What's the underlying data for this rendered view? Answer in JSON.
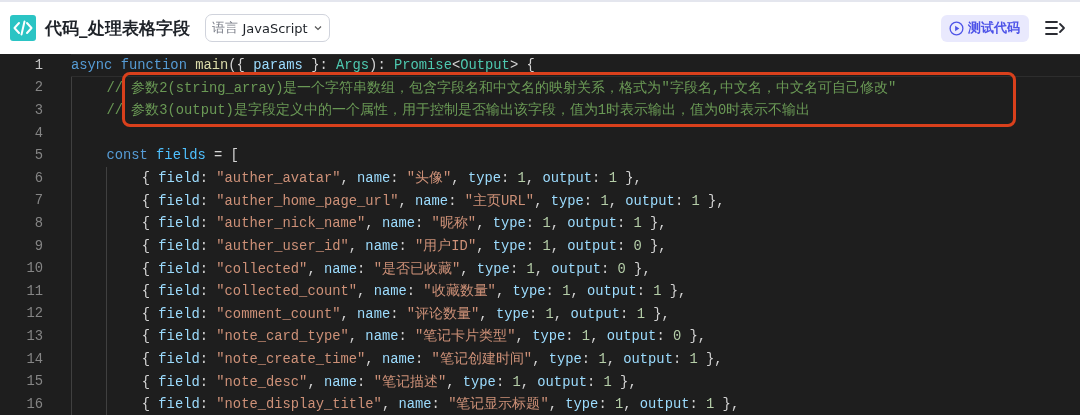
{
  "header": {
    "title": "代码_处理表格字段",
    "language": {
      "label": "语言",
      "value": "JavaScript"
    },
    "test_button": "测试代码"
  },
  "editor": {
    "lines": [
      {
        "number": "1",
        "current": true,
        "boxed": false,
        "tokens": [
          {
            "kind": "keyword",
            "text": "async "
          },
          {
            "kind": "keyword",
            "text": "function "
          },
          {
            "kind": "func",
            "text": "main"
          },
          {
            "kind": "punct",
            "text": "({ "
          },
          {
            "kind": "param",
            "text": "params"
          },
          {
            "kind": "punct",
            "text": " }: "
          },
          {
            "kind": "type",
            "text": "Args"
          },
          {
            "kind": "punct",
            "text": "): "
          },
          {
            "kind": "type",
            "text": "Promise"
          },
          {
            "kind": "punct",
            "text": "<"
          },
          {
            "kind": "type",
            "text": "Output"
          },
          {
            "kind": "punct",
            "text": "> {"
          }
        ],
        "children": [
          {
            "number": "2",
            "current": false,
            "boxed": true,
            "tokens": [
              {
                "kind": "comment",
                "text": "// 参数2(string_array)是一个字符串数组，包含字段名和中文名的映射关系，格式为\"字段名,中文名，中文名可自己修改\""
              }
            ]
          },
          {
            "number": "3",
            "current": false,
            "boxed": true,
            "tokens": [
              {
                "kind": "comment",
                "text": "// 参数3(output)是字段定义中的一个属性，用于控制是否输出该字段，值为1时表示输出，值为0时表示不输出"
              }
            ]
          },
          {
            "number": "4",
            "current": false,
            "boxed": false
          },
          {
            "number": "5",
            "current": false,
            "boxed": false,
            "tokens": [
              {
                "kind": "keyword",
                "text": "const "
              },
              {
                "kind": "const",
                "text": "fields"
              },
              {
                "kind": "punct",
                "text": " = ["
              }
            ],
            "children": [
              {
                "number": "6",
                "current": false,
                "boxed": false,
                "tokens": [
                  {
                    "kind": "punct",
                    "text": "{ "
                  },
                  {
                    "kind": "prop",
                    "text": "field"
                  },
                  {
                    "kind": "punct",
                    "text": ": "
                  },
                  {
                    "kind": "string",
                    "text": "\"auther_avatar\""
                  },
                  {
                    "kind": "punct",
                    "text": ", "
                  },
                  {
                    "kind": "prop",
                    "text": "name"
                  },
                  {
                    "kind": "punct",
                    "text": ": "
                  },
                  {
                    "kind": "string",
                    "text": "\"头像\""
                  },
                  {
                    "kind": "punct",
                    "text": ", "
                  },
                  {
                    "kind": "prop",
                    "text": "type"
                  },
                  {
                    "kind": "punct",
                    "text": ": "
                  },
                  {
                    "kind": "number",
                    "text": "1"
                  },
                  {
                    "kind": "punct",
                    "text": ", "
                  },
                  {
                    "kind": "prop",
                    "text": "output"
                  },
                  {
                    "kind": "punct",
                    "text": ": "
                  },
                  {
                    "kind": "number",
                    "text": "1"
                  },
                  {
                    "kind": "punct",
                    "text": " },"
                  }
                ]
              },
              {
                "number": "7",
                "current": false,
                "boxed": false,
                "tokens": [
                  {
                    "kind": "punct",
                    "text": "{ "
                  },
                  {
                    "kind": "prop",
                    "text": "field"
                  },
                  {
                    "kind": "punct",
                    "text": ": "
                  },
                  {
                    "kind": "string",
                    "text": "\"auther_home_page_url\""
                  },
                  {
                    "kind": "punct",
                    "text": ", "
                  },
                  {
                    "kind": "prop",
                    "text": "name"
                  },
                  {
                    "kind": "punct",
                    "text": ": "
                  },
                  {
                    "kind": "string",
                    "text": "\"主页URL\""
                  },
                  {
                    "kind": "punct",
                    "text": ", "
                  },
                  {
                    "kind": "prop",
                    "text": "type"
                  },
                  {
                    "kind": "punct",
                    "text": ": "
                  },
                  {
                    "kind": "number",
                    "text": "1"
                  },
                  {
                    "kind": "punct",
                    "text": ", "
                  },
                  {
                    "kind": "prop",
                    "text": "output"
                  },
                  {
                    "kind": "punct",
                    "text": ": "
                  },
                  {
                    "kind": "number",
                    "text": "1"
                  },
                  {
                    "kind": "punct",
                    "text": " },"
                  }
                ]
              },
              {
                "number": "8",
                "current": false,
                "boxed": false,
                "tokens": [
                  {
                    "kind": "punct",
                    "text": "{ "
                  },
                  {
                    "kind": "prop",
                    "text": "field"
                  },
                  {
                    "kind": "punct",
                    "text": ": "
                  },
                  {
                    "kind": "string",
                    "text": "\"auther_nick_name\""
                  },
                  {
                    "kind": "punct",
                    "text": ", "
                  },
                  {
                    "kind": "prop",
                    "text": "name"
                  },
                  {
                    "kind": "punct",
                    "text": ": "
                  },
                  {
                    "kind": "string",
                    "text": "\"昵称\""
                  },
                  {
                    "kind": "punct",
                    "text": ", "
                  },
                  {
                    "kind": "prop",
                    "text": "type"
                  },
                  {
                    "kind": "punct",
                    "text": ": "
                  },
                  {
                    "kind": "number",
                    "text": "1"
                  },
                  {
                    "kind": "punct",
                    "text": ", "
                  },
                  {
                    "kind": "prop",
                    "text": "output"
                  },
                  {
                    "kind": "punct",
                    "text": ": "
                  },
                  {
                    "kind": "number",
                    "text": "1"
                  },
                  {
                    "kind": "punct",
                    "text": " },"
                  }
                ]
              },
              {
                "number": "9",
                "current": false,
                "boxed": false,
                "tokens": [
                  {
                    "kind": "punct",
                    "text": "{ "
                  },
                  {
                    "kind": "prop",
                    "text": "field"
                  },
                  {
                    "kind": "punct",
                    "text": ": "
                  },
                  {
                    "kind": "string",
                    "text": "\"auther_user_id\""
                  },
                  {
                    "kind": "punct",
                    "text": ", "
                  },
                  {
                    "kind": "prop",
                    "text": "name"
                  },
                  {
                    "kind": "punct",
                    "text": ": "
                  },
                  {
                    "kind": "string",
                    "text": "\"用户ID\""
                  },
                  {
                    "kind": "punct",
                    "text": ", "
                  },
                  {
                    "kind": "prop",
                    "text": "type"
                  },
                  {
                    "kind": "punct",
                    "text": ": "
                  },
                  {
                    "kind": "number",
                    "text": "1"
                  },
                  {
                    "kind": "punct",
                    "text": ", "
                  },
                  {
                    "kind": "prop",
                    "text": "output"
                  },
                  {
                    "kind": "punct",
                    "text": ": "
                  },
                  {
                    "kind": "number",
                    "text": "0"
                  },
                  {
                    "kind": "punct",
                    "text": " },"
                  }
                ]
              },
              {
                "number": "10",
                "current": false,
                "boxed": false,
                "tokens": [
                  {
                    "kind": "punct",
                    "text": "{ "
                  },
                  {
                    "kind": "prop",
                    "text": "field"
                  },
                  {
                    "kind": "punct",
                    "text": ": "
                  },
                  {
                    "kind": "string",
                    "text": "\"collected\""
                  },
                  {
                    "kind": "punct",
                    "text": ", "
                  },
                  {
                    "kind": "prop",
                    "text": "name"
                  },
                  {
                    "kind": "punct",
                    "text": ": "
                  },
                  {
                    "kind": "string",
                    "text": "\"是否已收藏\""
                  },
                  {
                    "kind": "punct",
                    "text": ", "
                  },
                  {
                    "kind": "prop",
                    "text": "type"
                  },
                  {
                    "kind": "punct",
                    "text": ": "
                  },
                  {
                    "kind": "number",
                    "text": "1"
                  },
                  {
                    "kind": "punct",
                    "text": ", "
                  },
                  {
                    "kind": "prop",
                    "text": "output"
                  },
                  {
                    "kind": "punct",
                    "text": ": "
                  },
                  {
                    "kind": "number",
                    "text": "0"
                  },
                  {
                    "kind": "punct",
                    "text": " },"
                  }
                ]
              },
              {
                "number": "11",
                "current": false,
                "boxed": false,
                "tokens": [
                  {
                    "kind": "punct",
                    "text": "{ "
                  },
                  {
                    "kind": "prop",
                    "text": "field"
                  },
                  {
                    "kind": "punct",
                    "text": ": "
                  },
                  {
                    "kind": "string",
                    "text": "\"collected_count\""
                  },
                  {
                    "kind": "punct",
                    "text": ", "
                  },
                  {
                    "kind": "prop",
                    "text": "name"
                  },
                  {
                    "kind": "punct",
                    "text": ": "
                  },
                  {
                    "kind": "string",
                    "text": "\"收藏数量\""
                  },
                  {
                    "kind": "punct",
                    "text": ", "
                  },
                  {
                    "kind": "prop",
                    "text": "type"
                  },
                  {
                    "kind": "punct",
                    "text": ": "
                  },
                  {
                    "kind": "number",
                    "text": "1"
                  },
                  {
                    "kind": "punct",
                    "text": ", "
                  },
                  {
                    "kind": "prop",
                    "text": "output"
                  },
                  {
                    "kind": "punct",
                    "text": ": "
                  },
                  {
                    "kind": "number",
                    "text": "1"
                  },
                  {
                    "kind": "punct",
                    "text": " },"
                  }
                ]
              },
              {
                "number": "12",
                "current": false,
                "boxed": false,
                "tokens": [
                  {
                    "kind": "punct",
                    "text": "{ "
                  },
                  {
                    "kind": "prop",
                    "text": "field"
                  },
                  {
                    "kind": "punct",
                    "text": ": "
                  },
                  {
                    "kind": "string",
                    "text": "\"comment_count\""
                  },
                  {
                    "kind": "punct",
                    "text": ", "
                  },
                  {
                    "kind": "prop",
                    "text": "name"
                  },
                  {
                    "kind": "punct",
                    "text": ": "
                  },
                  {
                    "kind": "string",
                    "text": "\"评论数量\""
                  },
                  {
                    "kind": "punct",
                    "text": ", "
                  },
                  {
                    "kind": "prop",
                    "text": "type"
                  },
                  {
                    "kind": "punct",
                    "text": ": "
                  },
                  {
                    "kind": "number",
                    "text": "1"
                  },
                  {
                    "kind": "punct",
                    "text": ", "
                  },
                  {
                    "kind": "prop",
                    "text": "output"
                  },
                  {
                    "kind": "punct",
                    "text": ": "
                  },
                  {
                    "kind": "number",
                    "text": "1"
                  },
                  {
                    "kind": "punct",
                    "text": " },"
                  }
                ]
              },
              {
                "number": "13",
                "current": false,
                "boxed": false,
                "tokens": [
                  {
                    "kind": "punct",
                    "text": "{ "
                  },
                  {
                    "kind": "prop",
                    "text": "field"
                  },
                  {
                    "kind": "punct",
                    "text": ": "
                  },
                  {
                    "kind": "string",
                    "text": "\"note_card_type\""
                  },
                  {
                    "kind": "punct",
                    "text": ", "
                  },
                  {
                    "kind": "prop",
                    "text": "name"
                  },
                  {
                    "kind": "punct",
                    "text": ": "
                  },
                  {
                    "kind": "string",
                    "text": "\"笔记卡片类型\""
                  },
                  {
                    "kind": "punct",
                    "text": ", "
                  },
                  {
                    "kind": "prop",
                    "text": "type"
                  },
                  {
                    "kind": "punct",
                    "text": ": "
                  },
                  {
                    "kind": "number",
                    "text": "1"
                  },
                  {
                    "kind": "punct",
                    "text": ", "
                  },
                  {
                    "kind": "prop",
                    "text": "output"
                  },
                  {
                    "kind": "punct",
                    "text": ": "
                  },
                  {
                    "kind": "number",
                    "text": "0"
                  },
                  {
                    "kind": "punct",
                    "text": " },"
                  }
                ]
              },
              {
                "number": "14",
                "current": false,
                "boxed": false,
                "tokens": [
                  {
                    "kind": "punct",
                    "text": "{ "
                  },
                  {
                    "kind": "prop",
                    "text": "field"
                  },
                  {
                    "kind": "punct",
                    "text": ": "
                  },
                  {
                    "kind": "string",
                    "text": "\"note_create_time\""
                  },
                  {
                    "kind": "punct",
                    "text": ", "
                  },
                  {
                    "kind": "prop",
                    "text": "name"
                  },
                  {
                    "kind": "punct",
                    "text": ": "
                  },
                  {
                    "kind": "string",
                    "text": "\"笔记创建时间\""
                  },
                  {
                    "kind": "punct",
                    "text": ", "
                  },
                  {
                    "kind": "prop",
                    "text": "type"
                  },
                  {
                    "kind": "punct",
                    "text": ": "
                  },
                  {
                    "kind": "number",
                    "text": "1"
                  },
                  {
                    "kind": "punct",
                    "text": ", "
                  },
                  {
                    "kind": "prop",
                    "text": "output"
                  },
                  {
                    "kind": "punct",
                    "text": ": "
                  },
                  {
                    "kind": "number",
                    "text": "1"
                  },
                  {
                    "kind": "punct",
                    "text": " },"
                  }
                ]
              },
              {
                "number": "15",
                "current": false,
                "boxed": false,
                "tokens": [
                  {
                    "kind": "punct",
                    "text": "{ "
                  },
                  {
                    "kind": "prop",
                    "text": "field"
                  },
                  {
                    "kind": "punct",
                    "text": ": "
                  },
                  {
                    "kind": "string",
                    "text": "\"note_desc\""
                  },
                  {
                    "kind": "punct",
                    "text": ", "
                  },
                  {
                    "kind": "prop",
                    "text": "name"
                  },
                  {
                    "kind": "punct",
                    "text": ": "
                  },
                  {
                    "kind": "string",
                    "text": "\"笔记描述\""
                  },
                  {
                    "kind": "punct",
                    "text": ", "
                  },
                  {
                    "kind": "prop",
                    "text": "type"
                  },
                  {
                    "kind": "punct",
                    "text": ": "
                  },
                  {
                    "kind": "number",
                    "text": "1"
                  },
                  {
                    "kind": "punct",
                    "text": ", "
                  },
                  {
                    "kind": "prop",
                    "text": "output"
                  },
                  {
                    "kind": "punct",
                    "text": ": "
                  },
                  {
                    "kind": "number",
                    "text": "1"
                  },
                  {
                    "kind": "punct",
                    "text": " },"
                  }
                ]
              },
              {
                "number": "16",
                "current": false,
                "boxed": false,
                "tokens": [
                  {
                    "kind": "punct",
                    "text": "{ "
                  },
                  {
                    "kind": "prop",
                    "text": "field"
                  },
                  {
                    "kind": "punct",
                    "text": ": "
                  },
                  {
                    "kind": "string",
                    "text": "\"note_display_title\""
                  },
                  {
                    "kind": "punct",
                    "text": ", "
                  },
                  {
                    "kind": "prop",
                    "text": "name"
                  },
                  {
                    "kind": "punct",
                    "text": ": "
                  },
                  {
                    "kind": "string",
                    "text": "\"笔记显示标题\""
                  },
                  {
                    "kind": "punct",
                    "text": ", "
                  },
                  {
                    "kind": "prop",
                    "text": "type"
                  },
                  {
                    "kind": "punct",
                    "text": ": "
                  },
                  {
                    "kind": "number",
                    "text": "1"
                  },
                  {
                    "kind": "punct",
                    "text": ", "
                  },
                  {
                    "kind": "prop",
                    "text": "output"
                  },
                  {
                    "kind": "punct",
                    "text": ": "
                  },
                  {
                    "kind": "number",
                    "text": "1"
                  },
                  {
                    "kind": "punct",
                    "text": " },"
                  }
                ]
              }
            ]
          }
        ]
      }
    ]
  }
}
